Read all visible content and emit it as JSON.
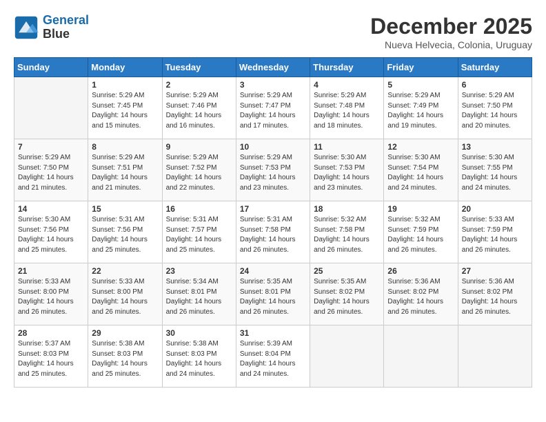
{
  "header": {
    "logo_line1": "General",
    "logo_line2": "Blue",
    "month": "December 2025",
    "location": "Nueva Helvecia, Colonia, Uruguay"
  },
  "weekdays": [
    "Sunday",
    "Monday",
    "Tuesday",
    "Wednesday",
    "Thursday",
    "Friday",
    "Saturday"
  ],
  "weeks": [
    [
      {
        "day": "",
        "info": ""
      },
      {
        "day": "1",
        "info": "Sunrise: 5:29 AM\nSunset: 7:45 PM\nDaylight: 14 hours\nand 15 minutes."
      },
      {
        "day": "2",
        "info": "Sunrise: 5:29 AM\nSunset: 7:46 PM\nDaylight: 14 hours\nand 16 minutes."
      },
      {
        "day": "3",
        "info": "Sunrise: 5:29 AM\nSunset: 7:47 PM\nDaylight: 14 hours\nand 17 minutes."
      },
      {
        "day": "4",
        "info": "Sunrise: 5:29 AM\nSunset: 7:48 PM\nDaylight: 14 hours\nand 18 minutes."
      },
      {
        "day": "5",
        "info": "Sunrise: 5:29 AM\nSunset: 7:49 PM\nDaylight: 14 hours\nand 19 minutes."
      },
      {
        "day": "6",
        "info": "Sunrise: 5:29 AM\nSunset: 7:50 PM\nDaylight: 14 hours\nand 20 minutes."
      }
    ],
    [
      {
        "day": "7",
        "info": "Sunrise: 5:29 AM\nSunset: 7:50 PM\nDaylight: 14 hours\nand 21 minutes."
      },
      {
        "day": "8",
        "info": "Sunrise: 5:29 AM\nSunset: 7:51 PM\nDaylight: 14 hours\nand 21 minutes."
      },
      {
        "day": "9",
        "info": "Sunrise: 5:29 AM\nSunset: 7:52 PM\nDaylight: 14 hours\nand 22 minutes."
      },
      {
        "day": "10",
        "info": "Sunrise: 5:29 AM\nSunset: 7:53 PM\nDaylight: 14 hours\nand 23 minutes."
      },
      {
        "day": "11",
        "info": "Sunrise: 5:30 AM\nSunset: 7:53 PM\nDaylight: 14 hours\nand 23 minutes."
      },
      {
        "day": "12",
        "info": "Sunrise: 5:30 AM\nSunset: 7:54 PM\nDaylight: 14 hours\nand 24 minutes."
      },
      {
        "day": "13",
        "info": "Sunrise: 5:30 AM\nSunset: 7:55 PM\nDaylight: 14 hours\nand 24 minutes."
      }
    ],
    [
      {
        "day": "14",
        "info": "Sunrise: 5:30 AM\nSunset: 7:56 PM\nDaylight: 14 hours\nand 25 minutes."
      },
      {
        "day": "15",
        "info": "Sunrise: 5:31 AM\nSunset: 7:56 PM\nDaylight: 14 hours\nand 25 minutes."
      },
      {
        "day": "16",
        "info": "Sunrise: 5:31 AM\nSunset: 7:57 PM\nDaylight: 14 hours\nand 25 minutes."
      },
      {
        "day": "17",
        "info": "Sunrise: 5:31 AM\nSunset: 7:58 PM\nDaylight: 14 hours\nand 26 minutes."
      },
      {
        "day": "18",
        "info": "Sunrise: 5:32 AM\nSunset: 7:58 PM\nDaylight: 14 hours\nand 26 minutes."
      },
      {
        "day": "19",
        "info": "Sunrise: 5:32 AM\nSunset: 7:59 PM\nDaylight: 14 hours\nand 26 minutes."
      },
      {
        "day": "20",
        "info": "Sunrise: 5:33 AM\nSunset: 7:59 PM\nDaylight: 14 hours\nand 26 minutes."
      }
    ],
    [
      {
        "day": "21",
        "info": "Sunrise: 5:33 AM\nSunset: 8:00 PM\nDaylight: 14 hours\nand 26 minutes."
      },
      {
        "day": "22",
        "info": "Sunrise: 5:33 AM\nSunset: 8:00 PM\nDaylight: 14 hours\nand 26 minutes."
      },
      {
        "day": "23",
        "info": "Sunrise: 5:34 AM\nSunset: 8:01 PM\nDaylight: 14 hours\nand 26 minutes."
      },
      {
        "day": "24",
        "info": "Sunrise: 5:35 AM\nSunset: 8:01 PM\nDaylight: 14 hours\nand 26 minutes."
      },
      {
        "day": "25",
        "info": "Sunrise: 5:35 AM\nSunset: 8:02 PM\nDaylight: 14 hours\nand 26 minutes."
      },
      {
        "day": "26",
        "info": "Sunrise: 5:36 AM\nSunset: 8:02 PM\nDaylight: 14 hours\nand 26 minutes."
      },
      {
        "day": "27",
        "info": "Sunrise: 5:36 AM\nSunset: 8:02 PM\nDaylight: 14 hours\nand 26 minutes."
      }
    ],
    [
      {
        "day": "28",
        "info": "Sunrise: 5:37 AM\nSunset: 8:03 PM\nDaylight: 14 hours\nand 25 minutes."
      },
      {
        "day": "29",
        "info": "Sunrise: 5:38 AM\nSunset: 8:03 PM\nDaylight: 14 hours\nand 25 minutes."
      },
      {
        "day": "30",
        "info": "Sunrise: 5:38 AM\nSunset: 8:03 PM\nDaylight: 14 hours\nand 24 minutes."
      },
      {
        "day": "31",
        "info": "Sunrise: 5:39 AM\nSunset: 8:04 PM\nDaylight: 14 hours\nand 24 minutes."
      },
      {
        "day": "",
        "info": ""
      },
      {
        "day": "",
        "info": ""
      },
      {
        "day": "",
        "info": ""
      }
    ]
  ]
}
